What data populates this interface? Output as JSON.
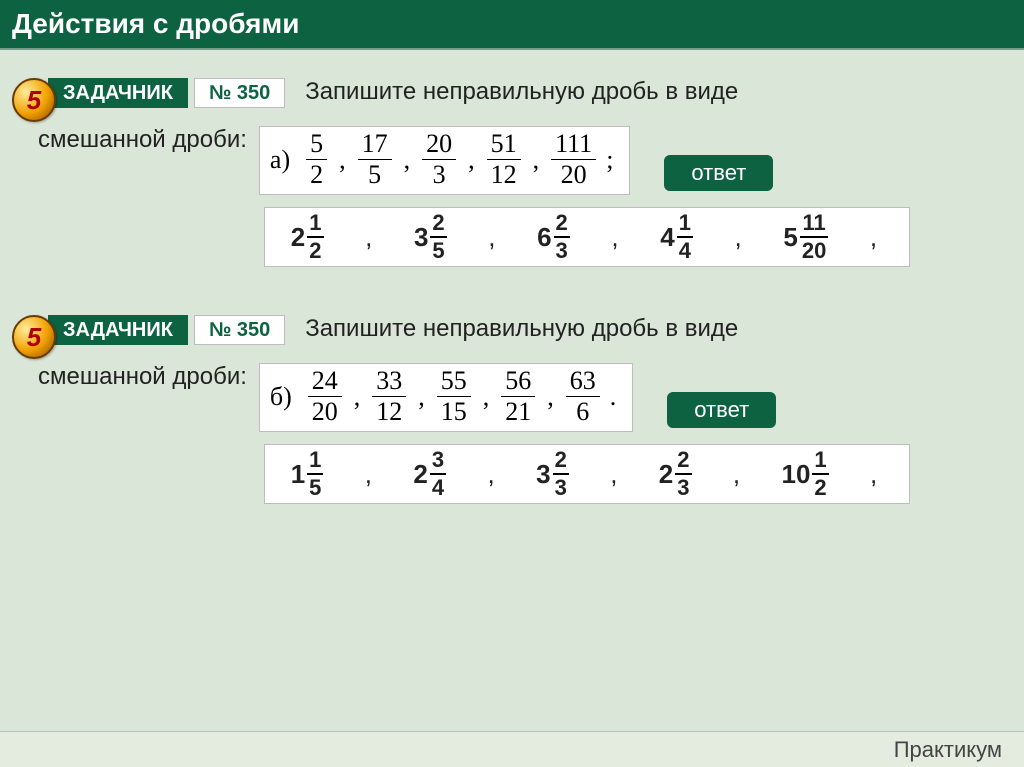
{
  "header": "Действия с дробями",
  "coin_digit": "5",
  "badge_label": "ЗАДАЧНИК",
  "answer_label": "ответ",
  "footer": "Практикум",
  "tasks": [
    {
      "num": "№ 350",
      "prompt1": "Запишите неправильную дробь в виде",
      "prompt2": "смешанной дроби:",
      "given_label": "а)",
      "given_end": ";",
      "given": [
        {
          "n": "5",
          "d": "2"
        },
        {
          "n": "17",
          "d": "5"
        },
        {
          "n": "20",
          "d": "3"
        },
        {
          "n": "51",
          "d": "12"
        },
        {
          "n": "111",
          "d": "20"
        }
      ],
      "answers": [
        {
          "w": "2",
          "n": "1",
          "d": "2"
        },
        {
          "w": "3",
          "n": "2",
          "d": "5"
        },
        {
          "w": "6",
          "n": "2",
          "d": "3"
        },
        {
          "w": "4",
          "n": "1",
          "d": "4"
        },
        {
          "w": "5",
          "n": "11",
          "d": "20"
        }
      ]
    },
    {
      "num": "№ 350",
      "prompt1": "Запишите неправильную дробь в виде",
      "prompt2": "смешанной дроби:",
      "given_label": "б)",
      "given_end": ".",
      "given": [
        {
          "n": "24",
          "d": "20"
        },
        {
          "n": "33",
          "d": "12"
        },
        {
          "n": "55",
          "d": "15"
        },
        {
          "n": "56",
          "d": "21"
        },
        {
          "n": "63",
          "d": "6"
        }
      ],
      "answers": [
        {
          "w": "1",
          "n": "1",
          "d": "5"
        },
        {
          "w": "2",
          "n": "3",
          "d": "4"
        },
        {
          "w": "3",
          "n": "2",
          "d": "3"
        },
        {
          "w": "2",
          "n": "2",
          "d": "3"
        },
        {
          "w": "10",
          "n": "1",
          "d": "2"
        }
      ]
    }
  ]
}
